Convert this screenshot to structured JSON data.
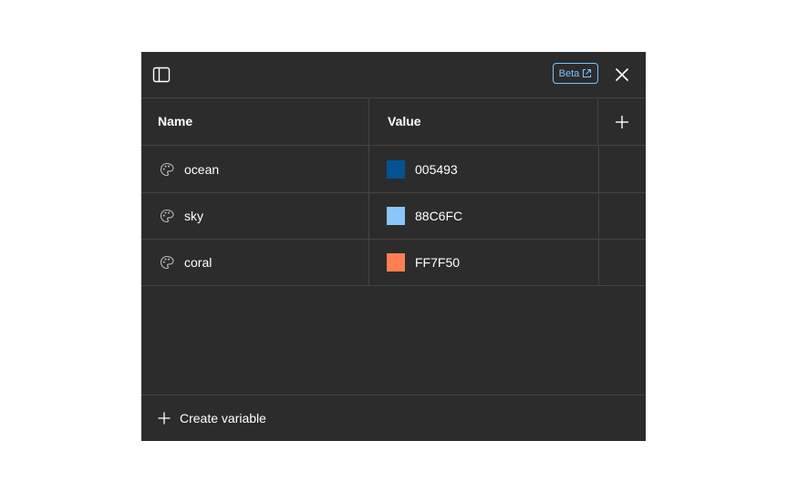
{
  "header": {
    "beta_label": "Beta"
  },
  "table": {
    "columns": {
      "name": "Name",
      "value": "Value"
    },
    "rows": [
      {
        "name": "ocean",
        "value": "005493",
        "color": "#005493"
      },
      {
        "name": "sky",
        "value": "88C6FC",
        "color": "#88C6FC"
      },
      {
        "name": "coral",
        "value": "FF7F50",
        "color": "#FF7F50"
      }
    ]
  },
  "footer": {
    "create_label": "Create variable"
  },
  "colors": {
    "panel_bg": "#2c2c2c",
    "divider": "#444444",
    "accent": "#7cc4fa",
    "text": "#ffffff"
  },
  "icons": {
    "sidebar": "sidebar-toggle-icon",
    "external": "external-link-icon",
    "close": "close-icon",
    "add": "plus-icon",
    "variable": "palette-icon"
  }
}
